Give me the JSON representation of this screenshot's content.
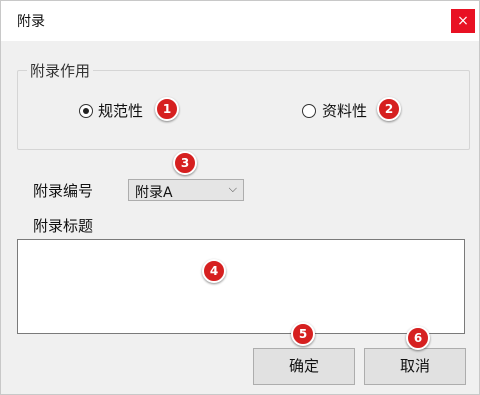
{
  "window": {
    "title": "附录",
    "close_glyph": "×"
  },
  "purpose_group": {
    "label": "附录作用",
    "options": [
      {
        "label": "规范性",
        "checked": true
      },
      {
        "label": "资料性",
        "checked": false
      }
    ]
  },
  "appendix_number": {
    "label": "附录编号",
    "selected": "附录A"
  },
  "appendix_title": {
    "label": "附录标题",
    "value": ""
  },
  "buttons": {
    "ok": "确定",
    "cancel": "取消"
  },
  "badges": [
    "1",
    "2",
    "3",
    "4",
    "5",
    "6"
  ],
  "colors": {
    "badge": "#d62020",
    "close_button": "#e81123"
  }
}
